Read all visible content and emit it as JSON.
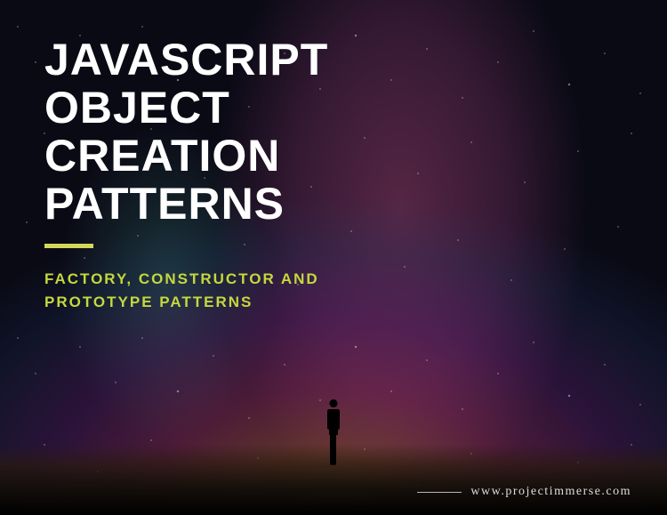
{
  "title": {
    "line1": "JAVASCRIPT",
    "line2": "OBJECT",
    "line3": "CREATION",
    "line4": "PATTERNS"
  },
  "subtitle": {
    "line1": "FACTORY, CONSTRUCTOR AND",
    "line2": "PROTOTYPE PATTERNS"
  },
  "footer": {
    "url": "www.projectimmerse.com"
  }
}
